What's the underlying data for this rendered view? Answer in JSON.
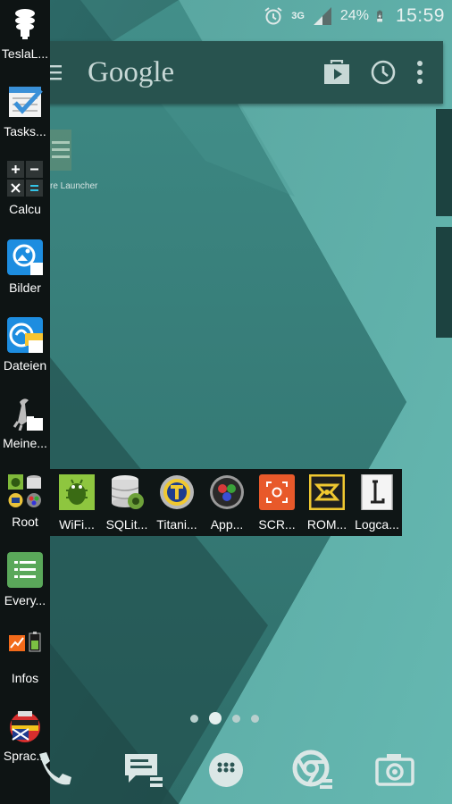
{
  "status_bar": {
    "network": "3G",
    "battery": "24%",
    "time": "15:59"
  },
  "search_bar": {
    "logo": "Google"
  },
  "sidebar": {
    "items": [
      {
        "label": "TeslaL..."
      },
      {
        "label": "Tasks..."
      },
      {
        "label": "Calcu"
      },
      {
        "label": "Bilder"
      },
      {
        "label": "Dateien"
      },
      {
        "label": "Meine..."
      },
      {
        "label": "Root"
      },
      {
        "label": "Every..."
      },
      {
        "label": "Infos"
      },
      {
        "label": "Sprac..."
      }
    ]
  },
  "ghost_launcher": {
    "label": "re Launcher"
  },
  "folder": {
    "apps": [
      {
        "label": "WiFi..."
      },
      {
        "label": "SQLit..."
      },
      {
        "label": "Titani..."
      },
      {
        "label": "App..."
      },
      {
        "label": "SCR..."
      },
      {
        "label": "ROM..."
      },
      {
        "label": "Logca..."
      }
    ]
  },
  "page_indicator": {
    "pages": 4,
    "active_page": 2
  },
  "colors": {
    "sidebar_bg": "#0e1414",
    "searchbar_bg": "#28534f",
    "wallpaper_dark": "#24514f",
    "wallpaper_light": "#5fb0aa"
  }
}
